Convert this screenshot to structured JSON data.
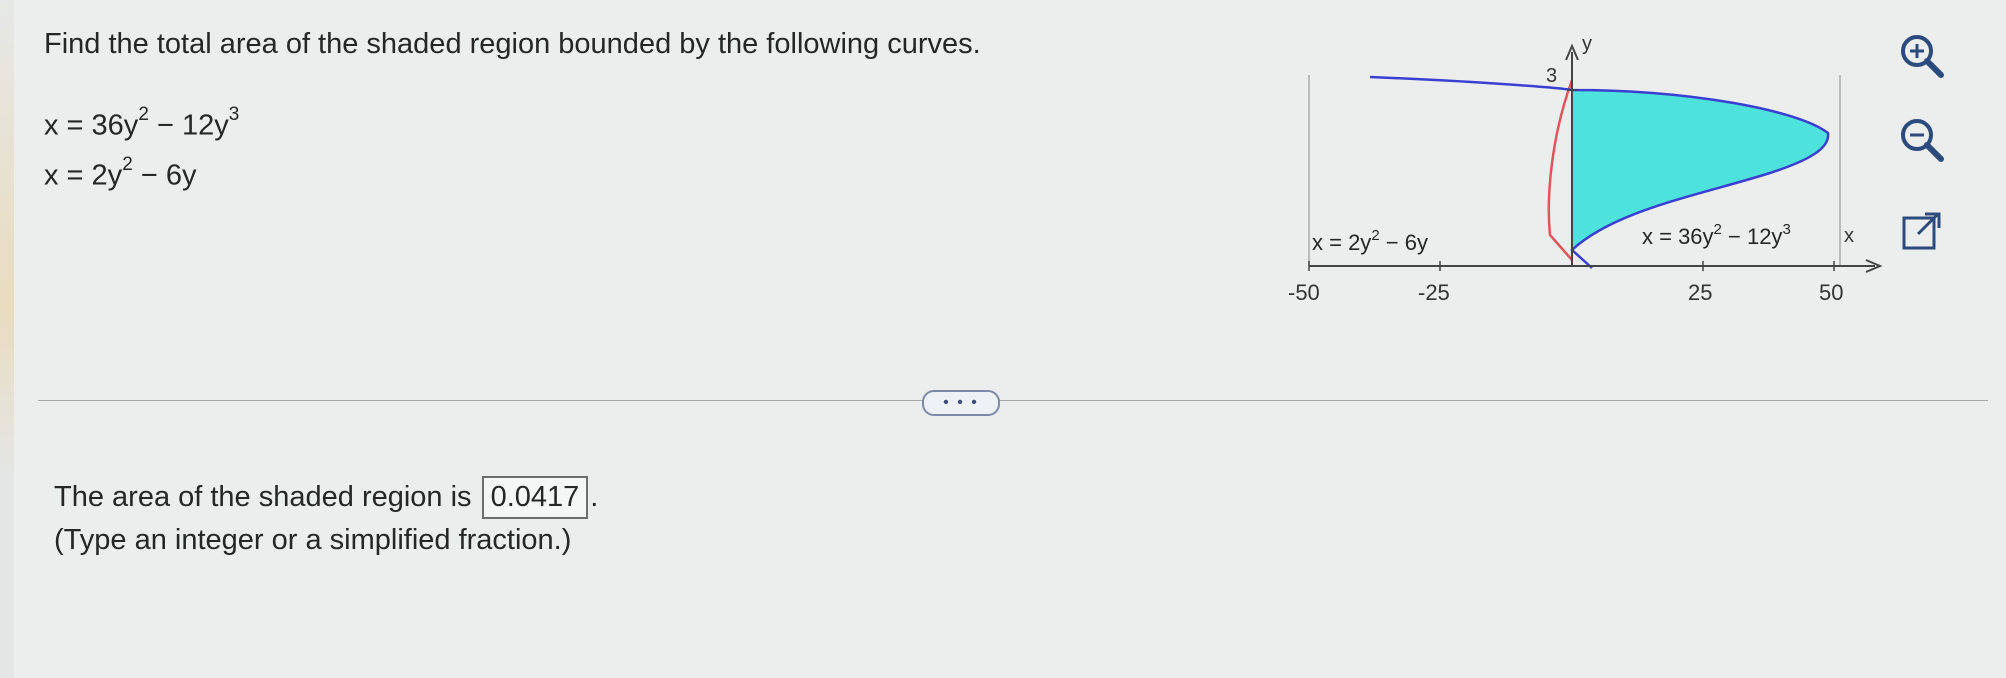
{
  "question": "Find the total area of the shaded region bounded by the following curves.",
  "equations": [
    {
      "lhs": "x = 36y",
      "exp1": "2",
      "mid": " − 12y",
      "exp2": "3"
    },
    {
      "lhs": "x = 2y",
      "exp1": "2",
      "mid": " − 6y",
      "exp2": ""
    }
  ],
  "graph": {
    "y_axis_label": "y",
    "x_axis_label": "x",
    "y_tick_label": "3",
    "x_tick_labels": [
      "-50",
      "-25",
      "25",
      "50"
    ],
    "curve1_label": {
      "lhs": "x = 2y",
      "exp1": "2",
      "mid": " − 6y"
    },
    "curve2_label": {
      "lhs": "x = 36y",
      "exp1": "2",
      "mid": " − 12y",
      "exp2": "3"
    },
    "shade_color": "#4de3dc",
    "curve_blue": "#3b3fd1",
    "curve_red": "#e0555a"
  },
  "tools": [
    "zoom-in-icon",
    "zoom-out-icon",
    "open-external-icon"
  ],
  "ellipsis": "• • •",
  "answer": {
    "prefix": "The area of the shaded region is",
    "value": "0.0417",
    "suffix": "."
  },
  "hint": "(Type an integer or a simplified fraction.)"
}
